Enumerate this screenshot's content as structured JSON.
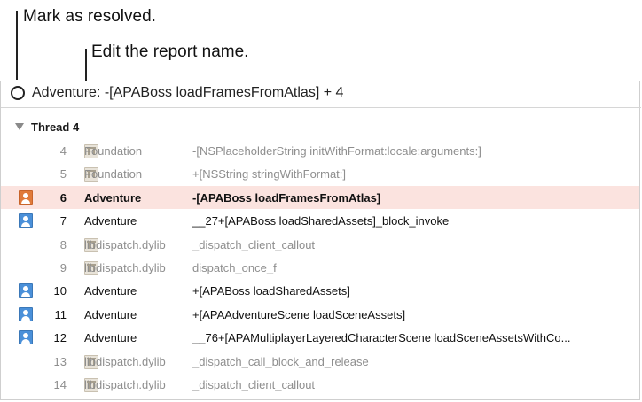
{
  "callouts": {
    "resolved": "Mark as resolved.",
    "rename": "Edit the report name."
  },
  "report": {
    "name": "Adventure: -[APABoss loadFramesFromAtlas] + 4"
  },
  "thread": {
    "label": "Thread 4"
  },
  "frames": [
    {
      "num": "4",
      "lib": "Foundation",
      "symbol": "-[NSPlaceholderString initWithFormat:locale:arguments:]",
      "icon": "library-icon",
      "style": "dim"
    },
    {
      "num": "5",
      "lib": "Foundation",
      "symbol": "+[NSString stringWithFormat:]",
      "icon": "library-icon",
      "style": "dim"
    },
    {
      "num": "6",
      "lib": "Adventure",
      "symbol": "-[APABoss loadFramesFromAtlas]",
      "icon": "user-code-icon",
      "style": "selected"
    },
    {
      "num": "7",
      "lib": "Adventure",
      "symbol": "__27+[APABoss loadSharedAssets]_block_invoke",
      "icon": "user-code-icon",
      "style": "bright"
    },
    {
      "num": "8",
      "lib": "libdispatch.dylib",
      "symbol": "_dispatch_client_callout",
      "icon": "library-icon",
      "style": "dim"
    },
    {
      "num": "9",
      "lib": "libdispatch.dylib",
      "symbol": "dispatch_once_f",
      "icon": "library-icon",
      "style": "dim"
    },
    {
      "num": "10",
      "lib": "Adventure",
      "symbol": "+[APABoss loadSharedAssets]",
      "icon": "user-code-icon",
      "style": "bright"
    },
    {
      "num": "11",
      "lib": "Adventure",
      "symbol": "+[APAAdventureScene loadSceneAssets]",
      "icon": "user-code-icon",
      "style": "bright"
    },
    {
      "num": "12",
      "lib": "Adventure",
      "symbol": "__76+[APAMultiplayerLayeredCharacterScene loadSceneAssetsWithCo...",
      "icon": "user-code-icon",
      "style": "bright"
    },
    {
      "num": "13",
      "lib": "libdispatch.dylib",
      "symbol": "_dispatch_call_block_and_release",
      "icon": "library-icon",
      "style": "dim"
    },
    {
      "num": "14",
      "lib": "libdispatch.dylib",
      "symbol": "_dispatch_client_callout",
      "icon": "library-icon",
      "style": "dim"
    }
  ]
}
